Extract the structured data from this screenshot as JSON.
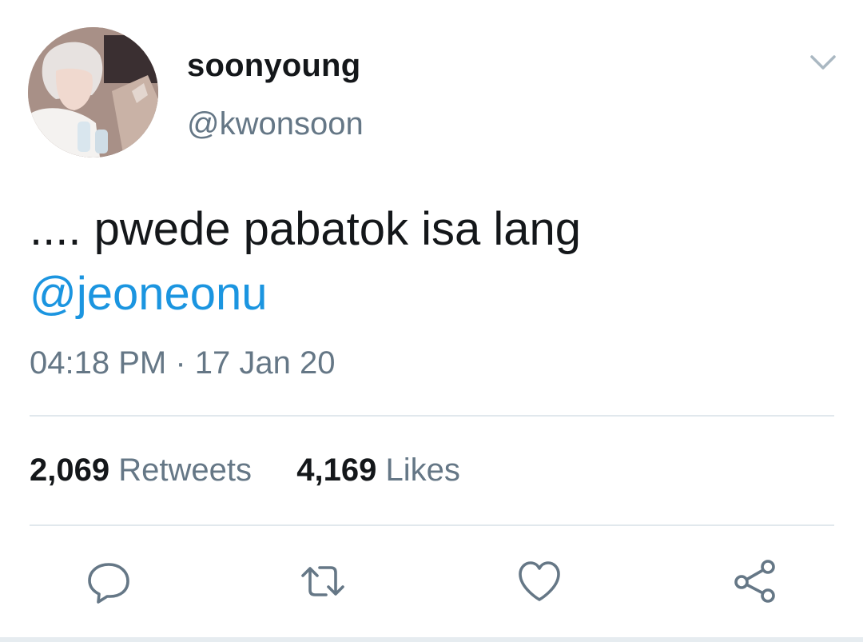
{
  "author": {
    "display_name": "soonyoung",
    "handle": "@kwonsoon"
  },
  "tweet": {
    "text": ".... pwede pabatok isa lang",
    "mention": "@jeoneonu",
    "timestamp": "04:18 PM · 17 Jan 20"
  },
  "stats": {
    "retweets_count": "2,069",
    "retweets_label": "Retweets",
    "likes_count": "4,169",
    "likes_label": "Likes"
  },
  "actions": [
    {
      "icon": "reply-icon"
    },
    {
      "icon": "retweet-icon"
    },
    {
      "icon": "like-heart-icon"
    },
    {
      "icon": "share-icon"
    }
  ],
  "colors": {
    "text_primary": "#14171a",
    "text_secondary": "#657786",
    "link": "#1b95e0",
    "divider": "#e1e8ed",
    "icon": "#657786"
  }
}
